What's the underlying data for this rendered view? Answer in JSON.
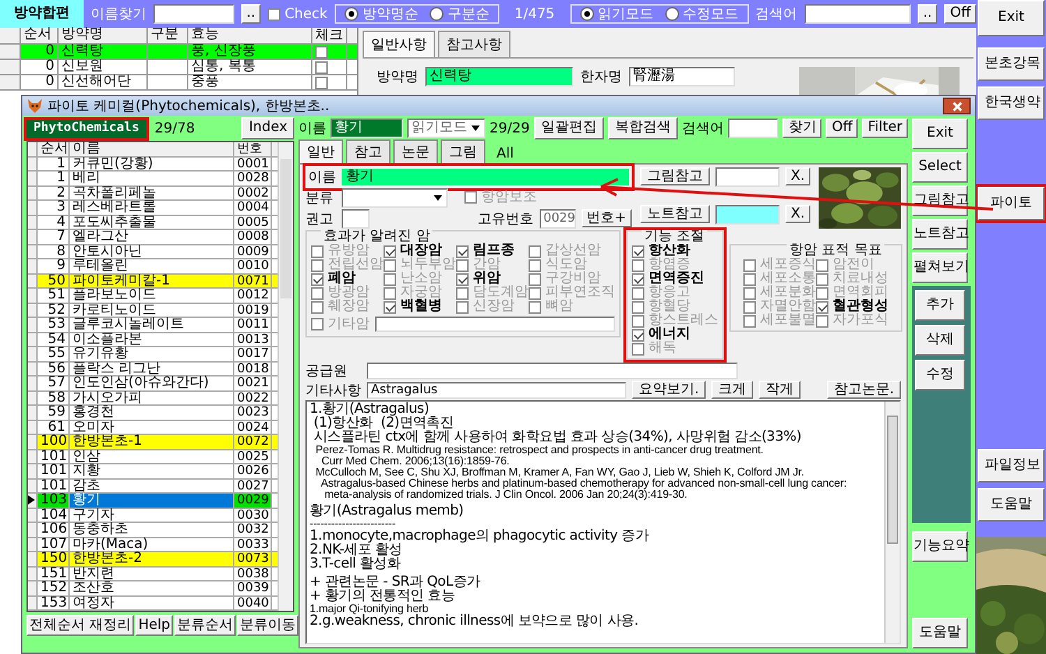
{
  "main_window": {
    "app_title": "방약합편",
    "name_search": {
      "label": "이름찾기"
    },
    "name_browse_button": "..",
    "check": {
      "label": "Check",
      "checked": false
    },
    "sort_options": [
      {
        "label": "방약명순",
        "selected": true
      },
      {
        "label": "구분순",
        "selected": false
      }
    ],
    "record_count": "1/475",
    "mode_options": [
      {
        "label": "읽기모드",
        "selected": true
      },
      {
        "label": "수정모드",
        "selected": false
      }
    ],
    "search": {
      "label": "검색어"
    },
    "search_browse_button": "..",
    "off_button": "Off",
    "side_buttons": [
      {
        "label": "Exit",
        "highlighted": false
      },
      {
        "label": "본초강목",
        "highlighted": false
      },
      {
        "label": "한국생약",
        "highlighted": false
      },
      {
        "label": "파이토",
        "highlighted": true
      },
      {
        "label": "파일정보",
        "highlighted": false
      },
      {
        "label": "도움말",
        "highlighted": false
      }
    ],
    "prescriptions": {
      "columns": [
        "순서",
        "방약명",
        "구분",
        "효능",
        "체크"
      ],
      "rows": [
        {
          "order": "0",
          "name": "신력탕",
          "effect": "풍, 신장풍",
          "checked": false,
          "selected": true
        },
        {
          "order": "0",
          "name": "신보원",
          "effect": "심통, 복통",
          "checked": false,
          "selected": false
        },
        {
          "order": "0",
          "name": "신선해어단",
          "effect": "중풍",
          "checked": false,
          "selected": false
        }
      ]
    },
    "detail_tabs": [
      {
        "label": "일반사항",
        "selected": true
      },
      {
        "label": "참고사항",
        "selected": false
      }
    ],
    "prescription_name": {
      "label": "방약명",
      "value": "신력탕"
    },
    "hanja_name": {
      "label": "한자명",
      "value": "腎瀝湯"
    }
  },
  "dialog": {
    "title": "파이토 케미컬(Phytochemicals), 한방본초..",
    "badge": {
      "label": "PhytoChemicals",
      "highlighted": true
    },
    "list_count": "29/78",
    "index_button": "Index",
    "list": {
      "columns": [
        "순서",
        "이름",
        "번호"
      ],
      "rows": [
        {
          "order": "1",
          "name": "커큐민(강황)",
          "number": "0001",
          "group": false,
          "selected": false
        },
        {
          "order": "1",
          "name": "베리",
          "number": "0028",
          "group": false,
          "selected": false
        },
        {
          "order": "2",
          "name": "곡차폴리페놀",
          "number": "0002",
          "group": false,
          "selected": false
        },
        {
          "order": "3",
          "name": "레스베라트롤",
          "number": "0004",
          "group": false,
          "selected": false
        },
        {
          "order": "4",
          "name": "포도씨추출물",
          "number": "0005",
          "group": false,
          "selected": false
        },
        {
          "order": "7",
          "name": "엘라그산",
          "number": "0008",
          "group": false,
          "selected": false
        },
        {
          "order": "8",
          "name": "안토시아닌",
          "number": "0009",
          "group": false,
          "selected": false
        },
        {
          "order": "9",
          "name": "루테올린",
          "number": "0010",
          "group": false,
          "selected": false
        },
        {
          "order": "50",
          "name": "파이토케미칼-1",
          "number": "0071",
          "group": true,
          "selected": false
        },
        {
          "order": "51",
          "name": "플라보노이드",
          "number": "0012",
          "group": false,
          "selected": false
        },
        {
          "order": "52",
          "name": "카로티노이드",
          "number": "0019",
          "group": false,
          "selected": false
        },
        {
          "order": "53",
          "name": "글루코시놀레이트",
          "number": "0011",
          "group": false,
          "selected": false
        },
        {
          "order": "54",
          "name": "이소플라본",
          "number": "0013",
          "group": false,
          "selected": false
        },
        {
          "order": "55",
          "name": "유기유황",
          "number": "0017",
          "group": false,
          "selected": false
        },
        {
          "order": "56",
          "name": "플락스 리그난",
          "number": "0018",
          "group": false,
          "selected": false
        },
        {
          "order": "57",
          "name": "인도인삼(아슈와간다)",
          "number": "0021",
          "group": false,
          "selected": false
        },
        {
          "order": "58",
          "name": "가시오가피",
          "number": "0022",
          "group": false,
          "selected": false
        },
        {
          "order": "59",
          "name": "홍경천",
          "number": "0023",
          "group": false,
          "selected": false
        },
        {
          "order": "61",
          "name": "오미자",
          "number": "0024",
          "group": false,
          "selected": false
        },
        {
          "order": "100",
          "name": "한방본초-1",
          "number": "0072",
          "group": true,
          "selected": false
        },
        {
          "order": "101",
          "name": "인삼",
          "number": "0025",
          "group": false,
          "selected": false
        },
        {
          "order": "101",
          "name": "지황",
          "number": "0026",
          "group": false,
          "selected": false
        },
        {
          "order": "101",
          "name": "감초",
          "number": "0027",
          "group": false,
          "selected": false
        },
        {
          "order": "103",
          "name": "황기",
          "number": "0029",
          "group": false,
          "selected": true
        },
        {
          "order": "104",
          "name": "구기자",
          "number": "0030",
          "group": false,
          "selected": false
        },
        {
          "order": "106",
          "name": "동충하초",
          "number": "0032",
          "group": false,
          "selected": false
        },
        {
          "order": "107",
          "name": "마카(Maca)",
          "number": "0033",
          "group": false,
          "selected": false
        },
        {
          "order": "150",
          "name": "한방본초-2",
          "number": "0073",
          "group": true,
          "selected": false
        },
        {
          "order": "151",
          "name": "반지련",
          "number": "0038",
          "group": false,
          "selected": false
        },
        {
          "order": "152",
          "name": "조산호",
          "number": "0039",
          "group": false,
          "selected": false
        },
        {
          "order": "153",
          "name": "여정자",
          "number": "0040",
          "group": false,
          "selected": false
        }
      ]
    },
    "list_buttons": [
      "전체순서 재정리",
      "Help",
      "분류순서",
      "분류이동"
    ],
    "toolbar": {
      "name_label": "이름",
      "name_value": "황기",
      "mode": "읽기모드",
      "count": "29/29",
      "batch_edit_button": "일괄편집",
      "combined_search_button": "복합검색",
      "search_label": "검색어",
      "find_button": "찾기",
      "off_button": "Off",
      "filter_button": "Filter"
    },
    "tabs": [
      {
        "label": "일반",
        "selected": true,
        "kind": "tab"
      },
      {
        "label": "참고",
        "selected": false,
        "kind": "tab"
      },
      {
        "label": "논문",
        "selected": false,
        "kind": "tab"
      },
      {
        "label": "그림",
        "selected": false,
        "kind": "tab"
      },
      {
        "label": "All",
        "selected": false,
        "kind": "text"
      }
    ],
    "form": {
      "name": {
        "label": "이름",
        "value": "황기",
        "highlighted": true
      },
      "category_label": "분류",
      "recommend_label": "권고",
      "adjuvant": {
        "label": "항암보조",
        "checked": false
      },
      "id_label": "고유번호",
      "id_value": "0029",
      "id_button": "번호+",
      "image_ref_button": "그림참고",
      "image_clear_button": "X.",
      "note_ref_button": "노트참고",
      "note_clear_button": "X.",
      "cancers": {
        "title": "효과가 알려진 암",
        "items": [
          {
            "label": "유방암",
            "checked": false
          },
          {
            "label": "대장암",
            "checked": true
          },
          {
            "label": "림프종",
            "checked": true
          },
          {
            "label": "갑상선암",
            "checked": false
          },
          {
            "label": "전립선암",
            "checked": false
          },
          {
            "label": "뇌두부암",
            "checked": false
          },
          {
            "label": "간암",
            "checked": false
          },
          {
            "label": "식도암",
            "checked": false
          },
          {
            "label": "폐암",
            "checked": true
          },
          {
            "label": "난소암",
            "checked": false
          },
          {
            "label": "위암",
            "checked": true
          },
          {
            "label": "구강비암",
            "checked": false
          },
          {
            "label": "방광암",
            "checked": false
          },
          {
            "label": "자궁암",
            "checked": false
          },
          {
            "label": "담도계암",
            "checked": false
          },
          {
            "label": "피부연조직",
            "checked": false
          },
          {
            "label": "췌장암",
            "checked": false
          },
          {
            "label": "백혈병",
            "checked": true
          },
          {
            "label": "신장암",
            "checked": false
          },
          {
            "label": "뼈암",
            "checked": false
          }
        ],
        "other": {
          "label": "기타암",
          "checked": false
        }
      },
      "functions": {
        "title": "기능 조절",
        "highlighted": true,
        "items": [
          {
            "label": "항산화",
            "checked": true
          },
          {
            "label": "항염증",
            "checked": false
          },
          {
            "label": "면역증진",
            "checked": true
          },
          {
            "label": "항응고",
            "checked": false
          },
          {
            "label": "항혈당",
            "checked": false
          },
          {
            "label": "항스트레스",
            "checked": false
          },
          {
            "label": "에너지",
            "checked": true
          },
          {
            "label": "해독",
            "checked": false
          }
        ]
      },
      "targets": {
        "title": "항암 표적 목표",
        "items": [
          {
            "label": "세포증식",
            "checked": false
          },
          {
            "label": "암전이",
            "checked": false
          },
          {
            "label": "세포소통",
            "checked": false
          },
          {
            "label": "치료내성",
            "checked": false
          },
          {
            "label": "세포분화",
            "checked": false
          },
          {
            "label": "면역회피",
            "checked": false
          },
          {
            "label": "자멸안함",
            "checked": false
          },
          {
            "label": "혈관형성",
            "checked": true
          },
          {
            "label": "세포불멸",
            "checked": false
          },
          {
            "label": "자가포식",
            "checked": false
          }
        ]
      },
      "source_label": "공급원",
      "notes_label": "기타사항",
      "notes_value": "Astragalus",
      "summary_button": "요약보기.",
      "larger_button": "크게",
      "smaller_button": "작게",
      "references_button": "참고논문.",
      "text_blocks": [
        [
          "1.황기(Astragalus)",
          " (1)항산화  (2)면역촉진",
          " 시스플라틴 ctx에 함께 사용하여 화학요법 효과 상승(34%), 사망위험 감소(33%)",
          "  Perez-Tomas R. Multidrug resistance: retrospect and prospects in anti-cancer drug treatment.",
          "    Curr Med Chem. 2006;13(16):1859-76.",
          "  McCulloch M, See C, Shu XJ, Broffman M, Kramer A, Fan WY, Gao J, Lieb W, Shieh K, Colford JM Jr.",
          "    Astragalus-based Chinese herbs and platinum-based chemotherapy for advanced non-small-cell lung cancer:",
          "     meta-analysis of randomized trials. J Clin Oncol. 2006 Jan 20;24(3):419-30."
        ],
        [
          "황기(Astragalus memb)",
          "------------------------",
          "1.monocyte,macrophage의 phagocytic activity 증가",
          "2.NK-세포 활성",
          "3.T-cell 활성화"
        ],
        [
          "+ 관련논문 - SR과 QoL증가",
          "+ 황기의 전통적인 효능",
          "1.major Qi-tonifying herb",
          "2.g.weakness, chronic illness에 보약으로 많이 사용."
        ]
      ]
    },
    "side_buttons": [
      "Exit",
      "Select",
      "그림참고",
      "노트참고",
      "펼쳐보기"
    ],
    "edit_buttons": [
      "추가",
      "삭제",
      "수정"
    ],
    "lower_buttons": [
      "기능요약",
      "도움말"
    ]
  }
}
